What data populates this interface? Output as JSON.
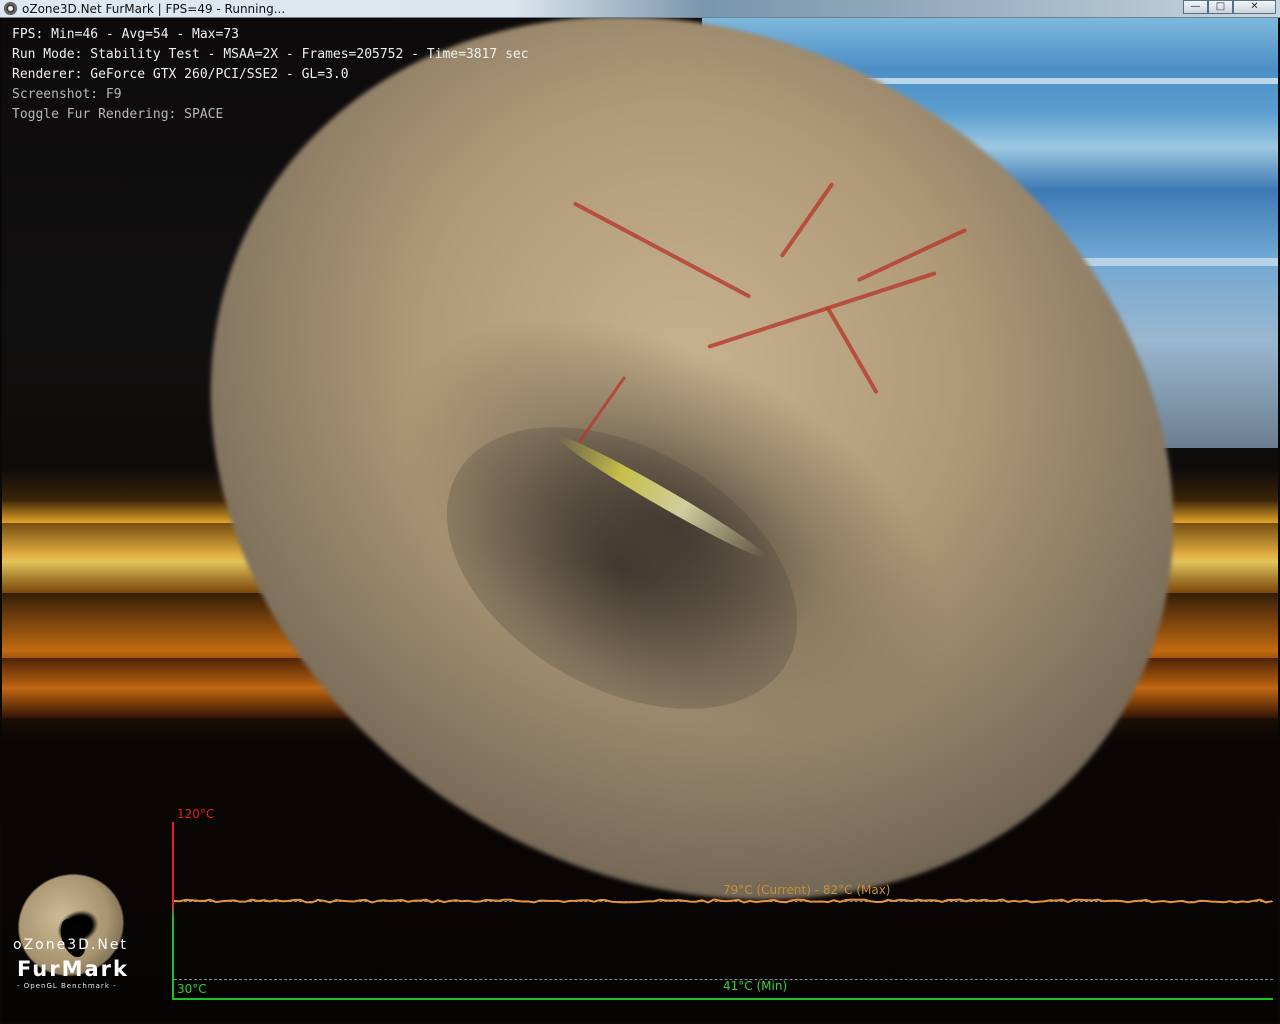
{
  "window": {
    "title": "oZone3D.Net FurMark | FPS=49 - Running...",
    "controls": {
      "minimize_icon": "minimize-icon",
      "maximize_icon": "maximize-icon",
      "close_icon": "close-icon"
    }
  },
  "osd": {
    "fps_line": "FPS: Min=46 - Avg=54 - Max=73",
    "run_mode_line": "Run Mode: Stability Test - MSAA=2X - Frames=205752 - Time=3817 sec",
    "renderer_line": "Renderer: GeForce GTX 260/PCI/SSE2 - GL=3.0",
    "screenshot_hint": "Screenshot: F9",
    "toggle_hint": "Toggle Fur Rendering: SPACE"
  },
  "temperature_graph": {
    "max_label": "120°C",
    "min_label": "30°C",
    "current_label": "79°C (Current) - 82°C (Max)",
    "min_value_label": "41°C (Min)",
    "current_temp_c": 79,
    "max_temp_c": 82,
    "min_temp_c": 41,
    "axis_max_c": 120,
    "axis_min_c": 30,
    "colors": {
      "max_axis": "#e02020",
      "min_axis": "#20c020",
      "curve": "#e6933c",
      "current_text": "#c2923a"
    }
  },
  "logo": {
    "line1": "oZone3D.Net",
    "line2": "FurMark",
    "line3": "- OpenGL Benchmark -"
  }
}
